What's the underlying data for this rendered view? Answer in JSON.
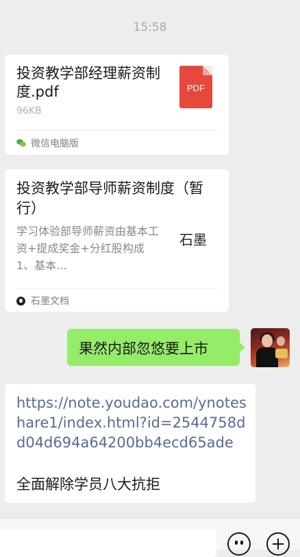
{
  "timestamp": "15:58",
  "file_message": {
    "title": "投资教学部经理薪资制度.pdf",
    "size": "96KB",
    "icon_label": "PDF",
    "source": "微信电脑版",
    "icon": "pdf-file-icon"
  },
  "link_message": {
    "title": "投资教学部导师薪资制度（暂行）",
    "description": "学习体验部导师薪资由基本工资+提成奖金+分红股构成 1、基本...",
    "thumbnail_text": "石墨",
    "source": "石墨文档"
  },
  "my_message": {
    "text": "果然内部忽悠要上市"
  },
  "text_message": {
    "url": "https://note.youdao.com/ynoteshare1/index.html?id=2544758dd04d694a64200bb4ecd65ade",
    "text": "全面解除学员八大抗拒"
  },
  "colors": {
    "background": "#ededed",
    "my_bubble": "#95ec69",
    "link": "#576b95",
    "pdf_red": "#e8473c"
  }
}
